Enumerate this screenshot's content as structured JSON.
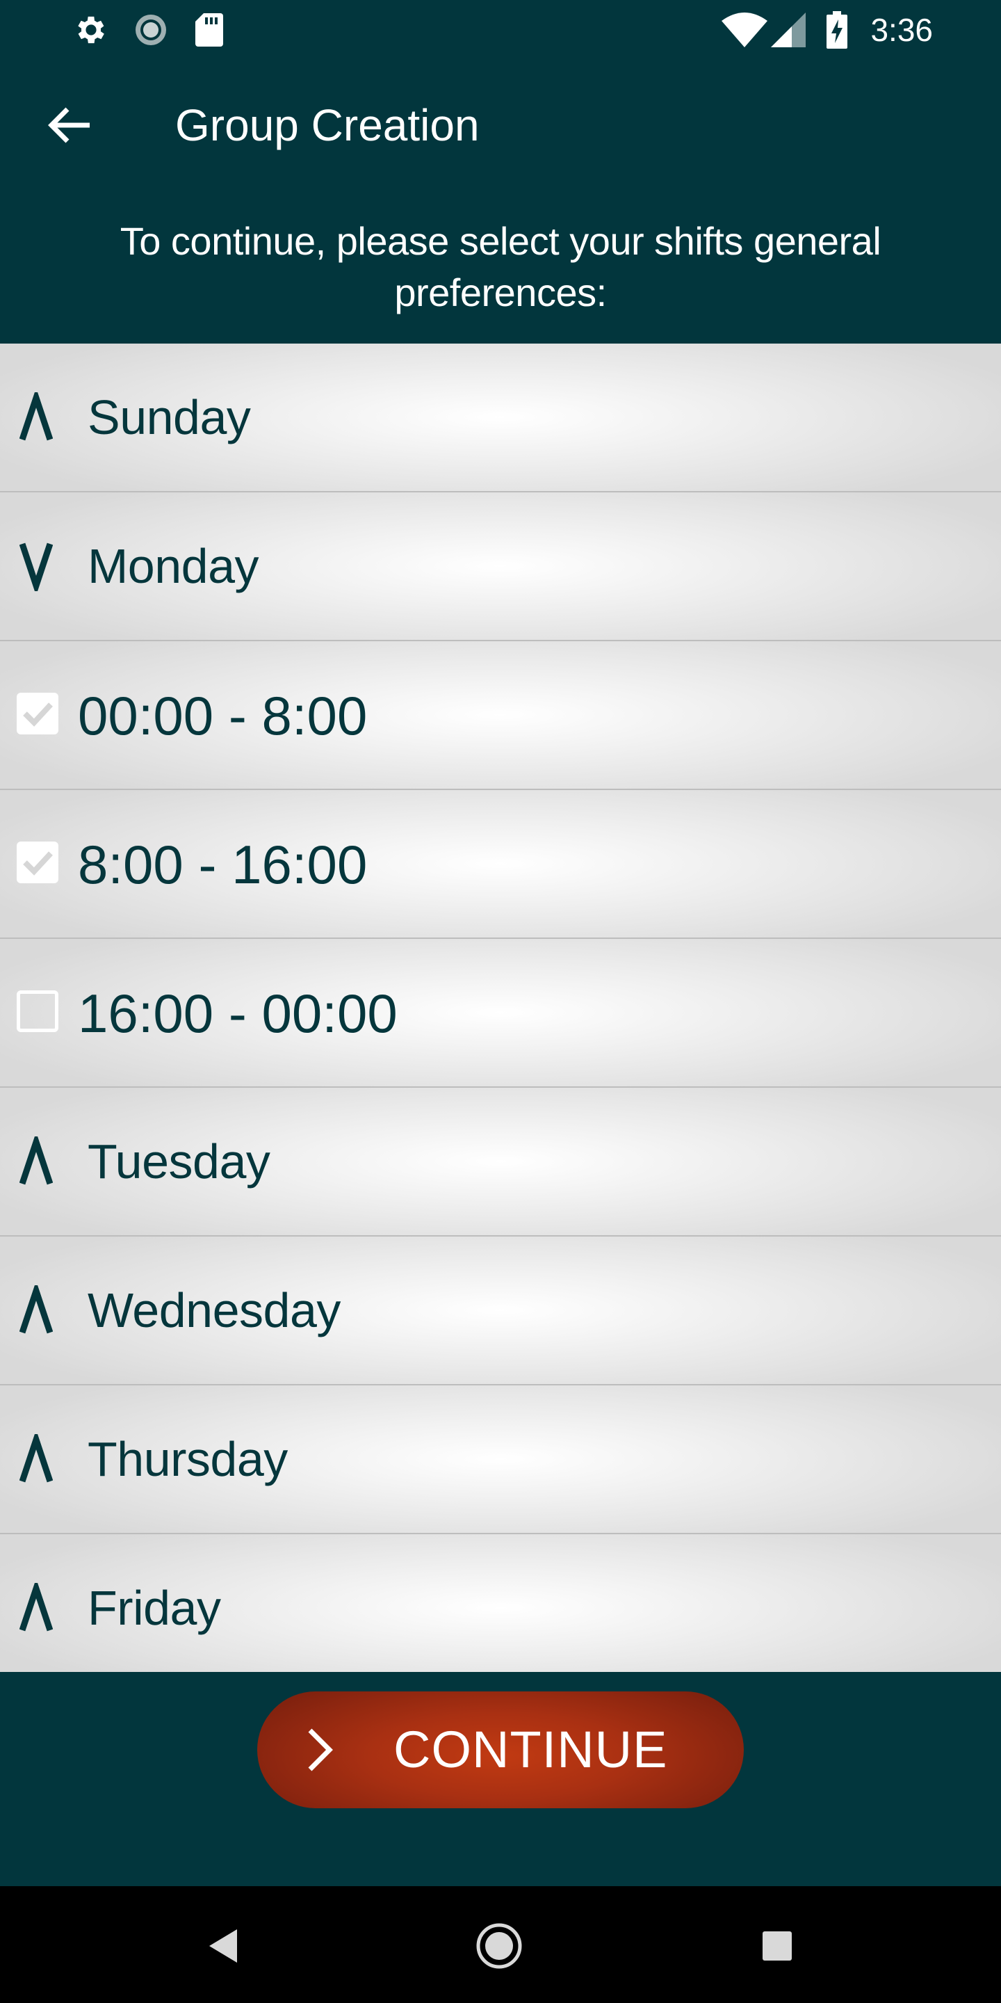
{
  "status_bar": {
    "time": "3:36",
    "icons": [
      "gear-icon",
      "sync-icon",
      "sd-card-icon",
      "wifi-icon",
      "signal-icon",
      "battery-charging-icon"
    ]
  },
  "app_bar": {
    "title": "Group Creation",
    "back_icon": "arrow-left-icon"
  },
  "instruction": "To continue, please select your shifts general preferences:",
  "days": [
    {
      "label": "Sunday",
      "expanded": false
    },
    {
      "label": "Monday",
      "expanded": true
    },
    {
      "label": "Tuesday",
      "expanded": false
    },
    {
      "label": "Wednesday",
      "expanded": false
    },
    {
      "label": "Thursday",
      "expanded": false
    },
    {
      "label": "Friday",
      "expanded": false
    }
  ],
  "shifts": [
    {
      "label": "00:00 - 8:00",
      "checked": true
    },
    {
      "label": "8:00 - 16:00",
      "checked": true
    },
    {
      "label": "16:00 - 00:00",
      "checked": false
    }
  ],
  "continue_button": {
    "label": "CONTINUE",
    "icon": "chevron-right-icon"
  },
  "nav_bar": {
    "icons": [
      "back-triangle-icon",
      "home-circle-icon",
      "recents-square-icon"
    ]
  },
  "colors": {
    "primary": "#02363d",
    "accent": "#b5330f",
    "text_dark": "#05363c",
    "nav": "#000000"
  }
}
